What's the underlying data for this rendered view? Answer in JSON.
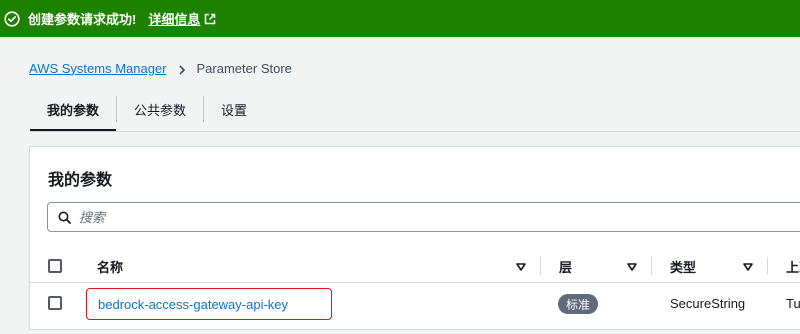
{
  "flash": {
    "message": "创建参数请求成功!",
    "details_link": "详细信息",
    "color": "#1d8102"
  },
  "breadcrumb": {
    "root": "AWS Systems Manager",
    "current": "Parameter Store"
  },
  "tabs": [
    {
      "label": "我的参数",
      "active": true
    },
    {
      "label": "公共参数",
      "active": false
    },
    {
      "label": "设置",
      "active": false
    }
  ],
  "panel": {
    "title": "我的参数",
    "search_placeholder": "搜索"
  },
  "table": {
    "columns": [
      "名称",
      "层",
      "类型",
      "上次"
    ],
    "rows": [
      {
        "name": "bedrock-access-gateway-api-key",
        "tier": "标准",
        "type": "SecureString",
        "modified": "Tue"
      }
    ]
  },
  "colors": {
    "link": "#0972d3",
    "highlight_border": "#d91515",
    "badge": "#5f6b7a"
  }
}
